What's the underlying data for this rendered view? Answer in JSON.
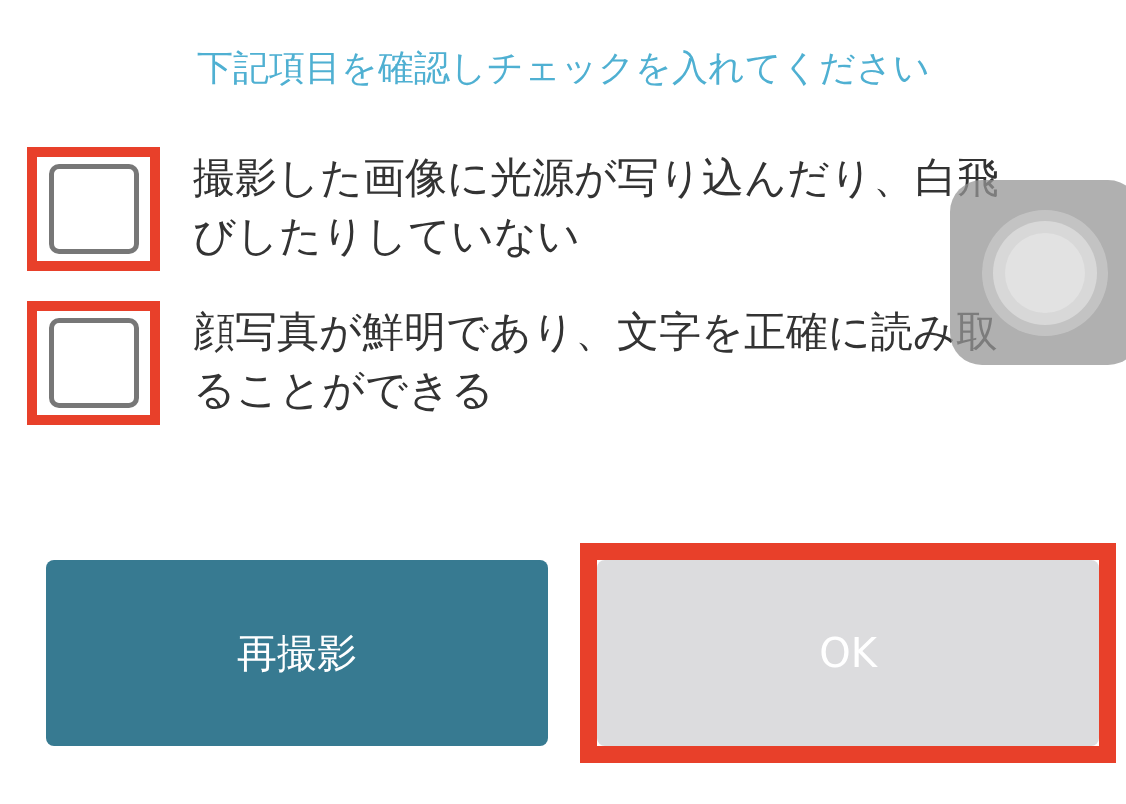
{
  "title": "下記項目を確認しチェックを入れてください",
  "items": [
    {
      "text": "撮影した画像に光源が写り込んだり、白飛びしたりしていない",
      "checked": false,
      "highlighted": true
    },
    {
      "text": "顔写真が鮮明であり、文字を正確に読み取ることができる",
      "checked": false,
      "highlighted": true
    }
  ],
  "buttons": [
    {
      "label": "再撮影",
      "kind": "retake",
      "disabled": false,
      "highlighted": false
    },
    {
      "label": "OK",
      "kind": "ok",
      "disabled": true,
      "highlighted": true
    }
  ]
}
